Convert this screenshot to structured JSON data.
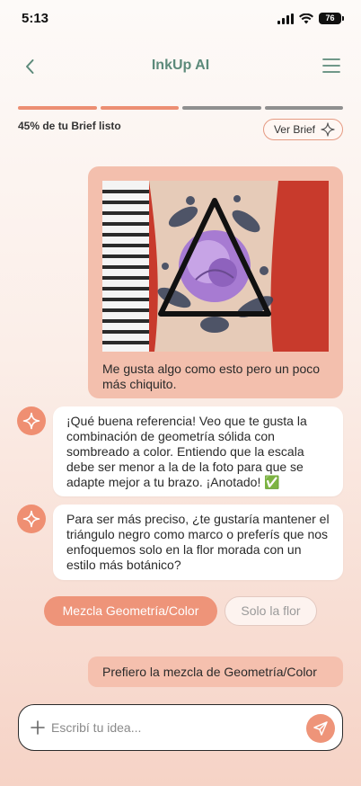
{
  "status_bar": {
    "time": "5:13",
    "battery": "76"
  },
  "header": {
    "title": "InkUp AI",
    "back_icon": "chevron-left-icon",
    "menu_icon": "hamburger-menu-icon"
  },
  "brief": {
    "progress_percent": 45,
    "segments_total": 4,
    "segments_done": 2,
    "progress_label": "45% de tu Brief listo",
    "button_label": "Ver Brief"
  },
  "colors": {
    "accent": "#ee9479",
    "title_green": "#5c8a7a",
    "user_bubble": "#f3bfad"
  },
  "chat": {
    "user_message": {
      "text": "Me gusta algo como esto pero un poco más chiquito.",
      "image": "tattoo-reference-photo"
    },
    "ai_messages": [
      {
        "text": "¡Qué buena referencia! Veo que te gusta la combinación de geometría sólida con sombreado a color. Entiendo que la escala debe ser menor a la de la foto para que se adapte mejor a tu brazo. ¡Anotado! ✅"
      },
      {
        "text": "Para ser más preciso, ¿te gustaría mantener el triángulo negro como marco o preferís que nos enfoquemos solo en la flor morada con un estilo más botánico?"
      }
    ],
    "options": [
      {
        "label": "Mezcla Geometría/Color"
      },
      {
        "label": "Solo la flor"
      }
    ],
    "user_reply": "Prefiero la mezcla de Geometría/Color"
  },
  "composer": {
    "placeholder": "Escribí tu idea..."
  }
}
